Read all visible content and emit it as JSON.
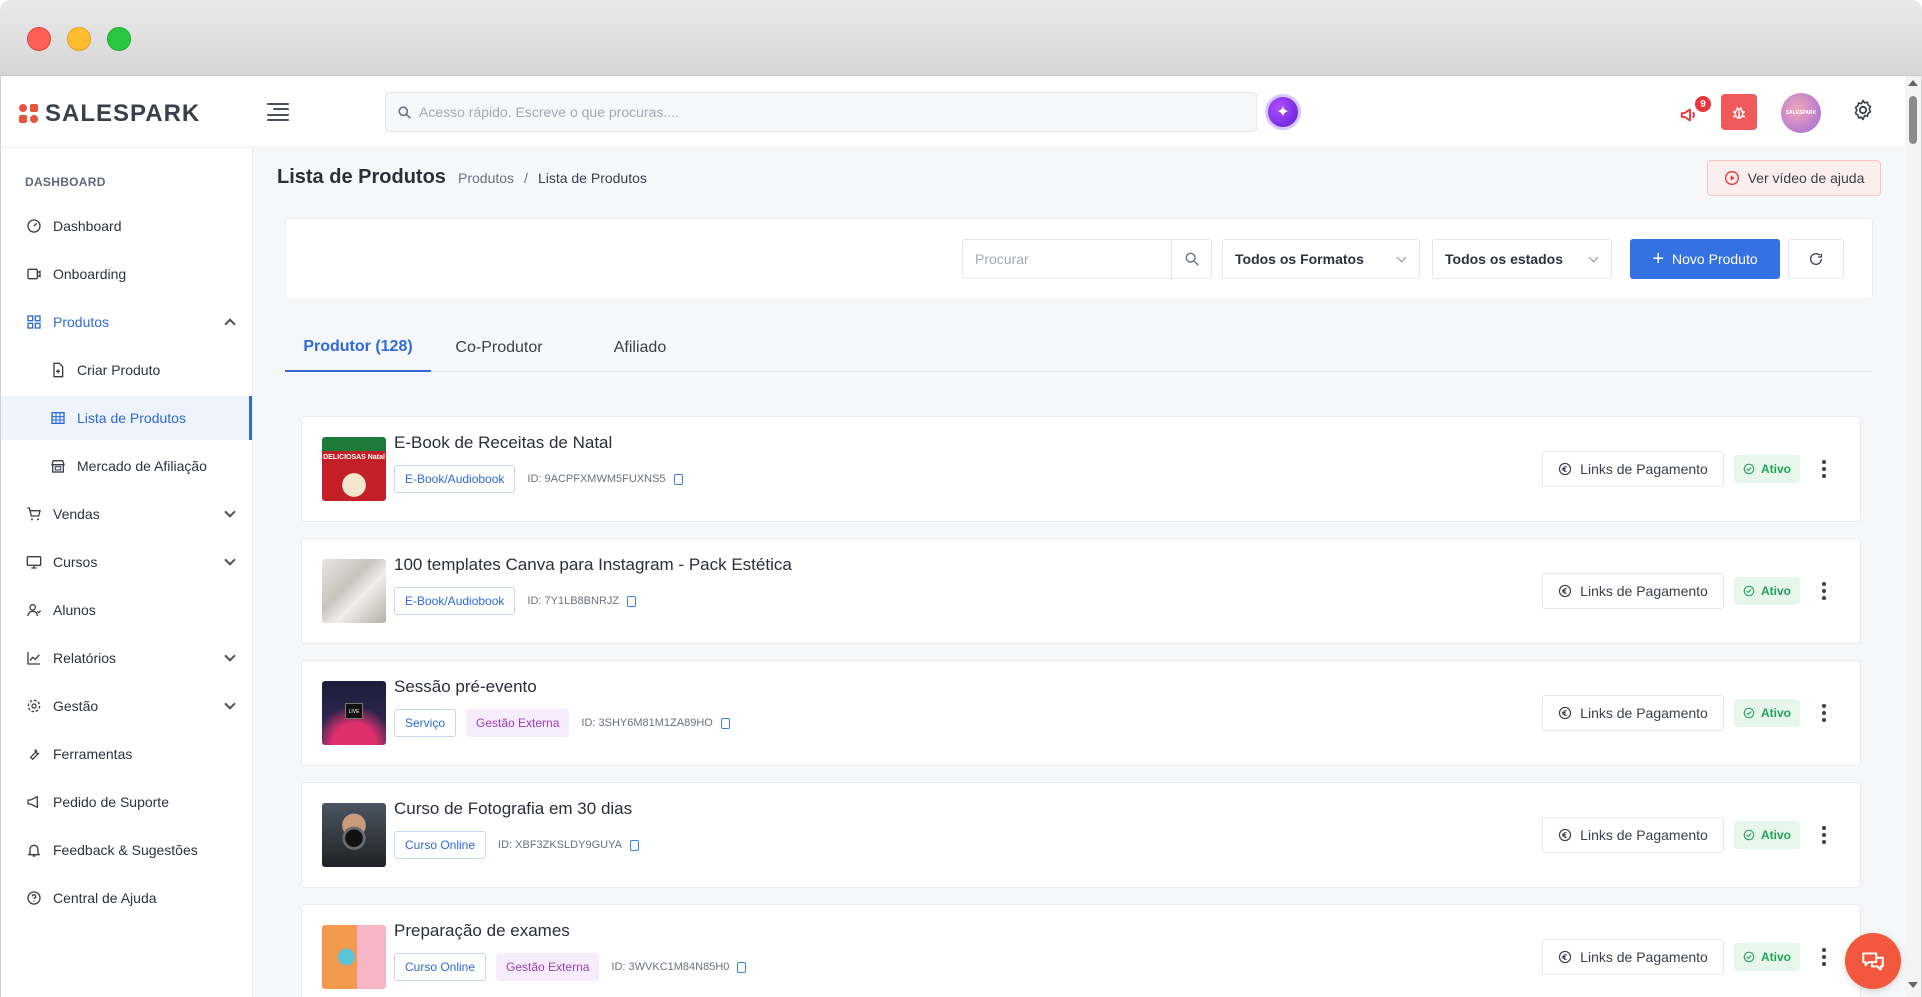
{
  "brand": {
    "name": "SALESPARK",
    "accent": "#3471e3",
    "logo_color": "#e8533c"
  },
  "topbar": {
    "search_placeholder": "Acesso rápido. Escreve o que procuras....",
    "notifications_count": "9",
    "avatar_text": "SALESPARK"
  },
  "sidebar": {
    "section": "DASHBOARD",
    "items": [
      {
        "label": "Dashboard",
        "icon": "dashboard-icon"
      },
      {
        "label": "Onboarding",
        "icon": "onboarding-icon"
      },
      {
        "label": "Produtos",
        "icon": "grid-icon",
        "expanded": true
      },
      {
        "label": "Criar Produto",
        "icon": "file-plus-icon"
      },
      {
        "label": "Lista de Produtos",
        "icon": "table-icon",
        "selected": true
      },
      {
        "label": "Mercado de Afiliação",
        "icon": "store-icon"
      },
      {
        "label": "Vendas",
        "icon": "cart-icon"
      },
      {
        "label": "Cursos",
        "icon": "monitor-icon"
      },
      {
        "label": "Alunos",
        "icon": "users-icon"
      },
      {
        "label": "Relatórios",
        "icon": "chart-line-icon"
      },
      {
        "label": "Gestão",
        "icon": "gear-icon"
      },
      {
        "label": "Ferramentas",
        "icon": "wrench-icon"
      },
      {
        "label": "Pedido de Suporte",
        "icon": "megaphone-icon"
      },
      {
        "label": "Feedback & Sugestões",
        "icon": "bell-icon"
      },
      {
        "label": "Central de Ajuda",
        "icon": "help-circle-icon"
      }
    ]
  },
  "page": {
    "title": "Lista de Produtos",
    "breadcrumb": [
      "Produtos",
      "/",
      "Lista de Produtos"
    ],
    "help_button": "Ver vídeo de ajuda"
  },
  "filters": {
    "search_placeholder": "Procurar",
    "format_select": "Todos os Formatos",
    "status_select": "Todos os estados",
    "new_button": "Novo Produto"
  },
  "tabs": [
    {
      "label": "Produtor (128)",
      "active": true
    },
    {
      "label": "Co-Produtor",
      "active": false
    },
    {
      "label": "Afiliado",
      "active": false
    }
  ],
  "products": [
    {
      "name": "E-Book de Receitas de Natal",
      "format": "E-Book/Audiobook",
      "external": "",
      "id_label": "ID: 9ACPFXMWM5FUXNS5",
      "links": "Links de Pagamento",
      "status": "Ativo",
      "thumb": "ebook-natal",
      "thumb_text": "DELICIOSAS Natal"
    },
    {
      "name": "100 templates Canva para Instagram - Pack Estética",
      "format": "E-Book/Audiobook",
      "external": "",
      "id_label": "ID: 7Y1LB8BNRJZ",
      "links": "Links de Pagamento",
      "status": "Ativo",
      "thumb": "canva-pack",
      "thumb_text": ""
    },
    {
      "name": "Sessão pré-evento",
      "format": "Serviço",
      "external": "Gestão Externa",
      "id_label": "ID: 3SHY6M81M1ZA89HO",
      "links": "Links de Pagamento",
      "status": "Ativo",
      "thumb": "live-event",
      "thumb_text": "LIVE"
    },
    {
      "name": "Curso de Fotografia em 30 dias",
      "format": "Curso Online",
      "external": "",
      "id_label": "ID: XBF3ZKSLDY9GUYA",
      "links": "Links de Pagamento",
      "status": "Ativo",
      "thumb": "photography",
      "thumb_text": ""
    },
    {
      "name": "Preparação de exames",
      "format": "Curso Online",
      "external": "Gestão Externa",
      "id_label": "ID: 3WVKC1M84N85H0",
      "links": "Links de Pagamento",
      "status": "Ativo",
      "thumb": "exams",
      "thumb_text": ""
    }
  ]
}
